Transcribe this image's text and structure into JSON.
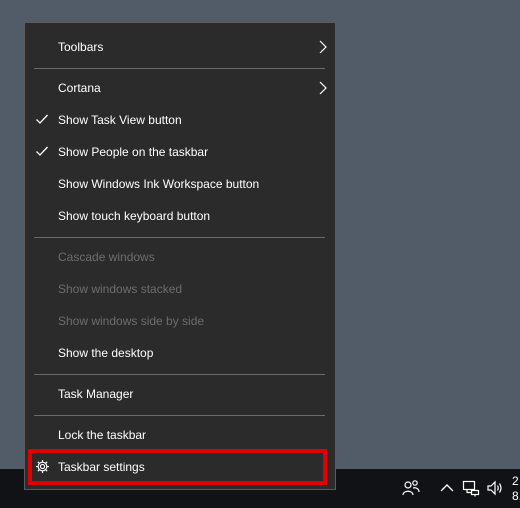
{
  "menu": {
    "items": [
      {
        "label": "Toolbars",
        "submenu": true
      },
      {
        "label": "Cortana",
        "submenu": true
      },
      {
        "label": "Show Task View button",
        "checked": true
      },
      {
        "label": "Show People on the taskbar",
        "checked": true
      },
      {
        "label": "Show Windows Ink Workspace button"
      },
      {
        "label": "Show touch keyboard button"
      },
      {
        "label": "Cascade windows",
        "disabled": true
      },
      {
        "label": "Show windows stacked",
        "disabled": true
      },
      {
        "label": "Show windows side by side",
        "disabled": true
      },
      {
        "label": "Show the desktop"
      },
      {
        "label": "Task Manager"
      },
      {
        "label": "Lock the taskbar"
      },
      {
        "label": "Taskbar settings",
        "icon": "gear-icon",
        "highlighted": true
      }
    ]
  },
  "tray": {
    "icons": [
      "people-icon",
      "chevron-up-icon",
      "network-icon",
      "volume-icon"
    ],
    "clock_fragments": [
      "2",
      "8,"
    ]
  },
  "colors": {
    "desktop": "#525b68",
    "menu_bg": "#2b2b2b",
    "taskbar": "#101216",
    "highlight": "#e00000",
    "disabled_text": "#6d6d6d"
  }
}
